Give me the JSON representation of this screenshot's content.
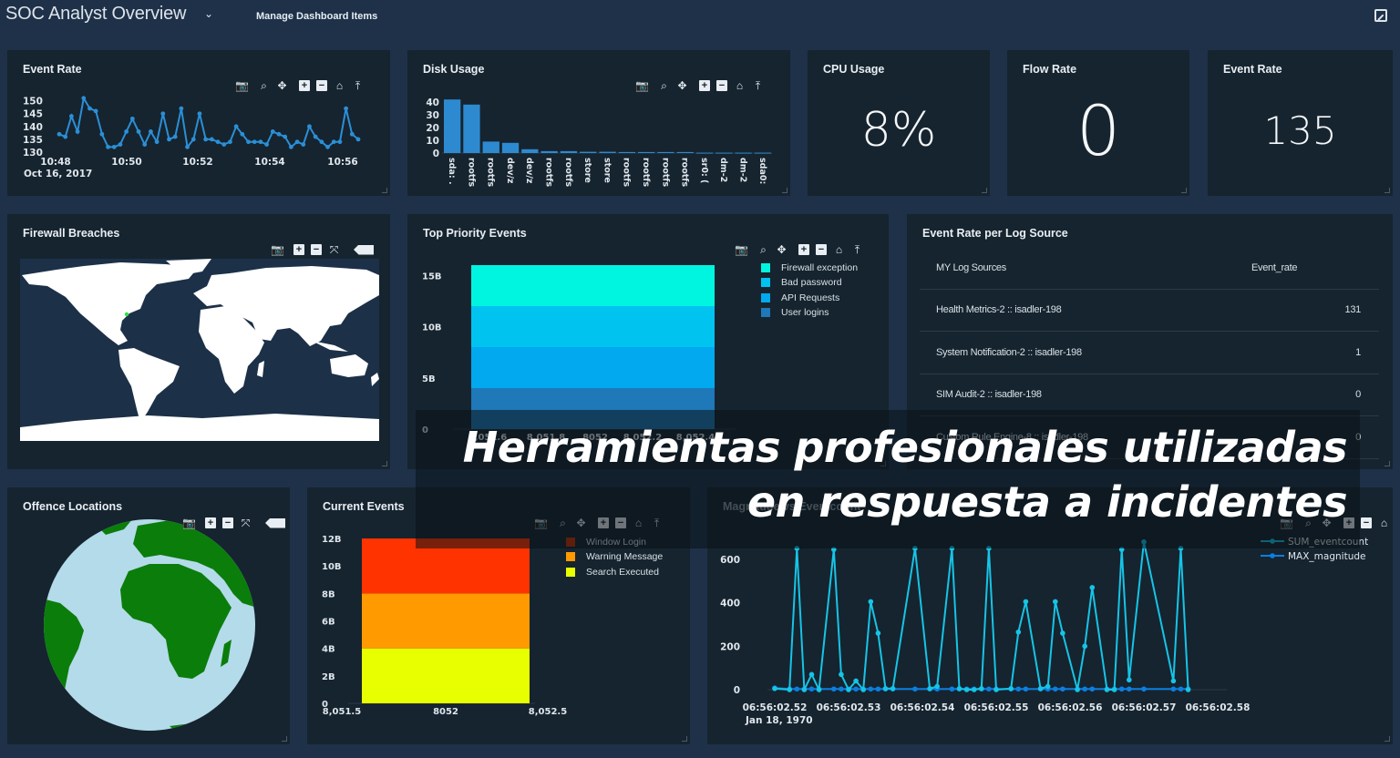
{
  "header": {
    "title": "SOC Analyst Overview",
    "chevron": "⌄",
    "manage_label": "Manage Dashboard Items",
    "popout_icon": "popout-icon"
  },
  "colors": {
    "background": "#1e3148",
    "panel": "#16242f",
    "line_blue": "#2b8fd6",
    "bar_blue": "#2d8ad0"
  },
  "toolbar_icons": [
    "camera-icon",
    "zoom-icon",
    "pan-icon",
    "zoom-in-icon",
    "zoom-out-icon",
    "home-icon",
    "autoscale-icon"
  ],
  "map_toolbar_icons": [
    "camera-icon",
    "zoom-in-icon",
    "zoom-out-icon",
    "fit-icon",
    "tag-icon"
  ],
  "panels": {
    "event_rate_chart": {
      "title": "Event Rate"
    },
    "disk_usage": {
      "title": "Disk Usage"
    },
    "cpu_usage": {
      "title": "CPU Usage",
      "value": "8%"
    },
    "flow_rate": {
      "title": "Flow Rate",
      "value": "0"
    },
    "event_rate_kpi": {
      "title": "Event Rate",
      "value": "135"
    },
    "firewall_breaches": {
      "title": "Firewall Breaches",
      "marker": "United States East Coast"
    },
    "top_priority": {
      "title": "Top Priority Events"
    },
    "log_source": {
      "title": "Event Rate per Log Source",
      "headers": [
        "MY Log Sources",
        "Event_rate"
      ],
      "rows": [
        [
          "Health Metrics-2 :: isadler-198",
          "131"
        ],
        [
          "System Notification-2 :: isadler-198",
          "1"
        ],
        [
          "SIM Audit-2 :: isadler-198",
          "0"
        ],
        [
          "Custom Rule Engine-8 :: isadler-198",
          "0"
        ]
      ]
    },
    "offence_locations": {
      "title": "Offence Locations"
    },
    "current_events": {
      "title": "Current Events"
    },
    "magnitude": {
      "title": "Magnitude vs Eventcount"
    }
  },
  "overlay": {
    "line1": "Herramientas profesionales utilizadas",
    "line2": "en respuesta a incidentes"
  },
  "chart_data": [
    {
      "id": "event_rate",
      "type": "line",
      "title": "Event Rate",
      "ylim": [
        130,
        152
      ],
      "yticks": [
        "150",
        "145",
        "140",
        "135",
        "130"
      ],
      "ytick_values": [
        150,
        145,
        140,
        135,
        130
      ],
      "xticks": [
        "10:48",
        "10:50",
        "10:52",
        "10:54",
        "10:56"
      ],
      "xsub": "Oct 16, 2017",
      "values": [
        137,
        136,
        144,
        138,
        151,
        147,
        146,
        137,
        132,
        132,
        133,
        138,
        143,
        138,
        133,
        138,
        134,
        145,
        135,
        136,
        147,
        132,
        135,
        145,
        135,
        135,
        134,
        133,
        134,
        140,
        137,
        134,
        134,
        134,
        133,
        138,
        137,
        136,
        132,
        134,
        133,
        140,
        136,
        134,
        132,
        134,
        134,
        147,
        137,
        135
      ]
    },
    {
      "id": "disk_usage",
      "type": "bar",
      "title": "Disk Usage",
      "ylim": [
        0,
        45
      ],
      "yticks": [
        "40",
        "30",
        "20",
        "10",
        "0"
      ],
      "ytick_values": [
        40,
        30,
        20,
        10,
        0
      ],
      "categories": [
        "sda: .",
        "rootfs",
        "rootfs",
        "dev/z",
        "dev/z",
        "rootfs",
        "rootfs",
        "store",
        "store",
        "rootfs",
        "rootfs",
        "rootfs",
        "rootfs",
        "sr0: (",
        "dm-2",
        "dm-2",
        "sda0:"
      ],
      "values": [
        42,
        38,
        9,
        8,
        3,
        1.5,
        1.5,
        1,
        1,
        0.8,
        0.8,
        0.8,
        0.8,
        0.3,
        0.3,
        0.3,
        0.3
      ]
    },
    {
      "id": "top_priority",
      "type": "bar",
      "stacked": true,
      "title": "Top Priority Events",
      "ylim": [
        0,
        16
      ],
      "yticks": [
        "15B",
        "10B",
        "5B",
        "0"
      ],
      "ytick_values": [
        15,
        10,
        5,
        0
      ],
      "xticks": [
        "8,051.6",
        "8,051.8",
        "8052",
        "8,052.2",
        "8,052.4"
      ],
      "series": [
        {
          "name": "User logins",
          "value": 4,
          "color": "#1f78b8"
        },
        {
          "name": "API Requests",
          "value": 4,
          "color": "#02a9ef"
        },
        {
          "name": "Bad password",
          "value": 4,
          "color": "#00c3f0"
        },
        {
          "name": "Firewall exception",
          "value": 4,
          "color": "#00f5e0"
        }
      ],
      "legend": [
        "Firewall exception",
        "Bad password",
        "API Requests",
        "User logins"
      ]
    },
    {
      "id": "current_events",
      "type": "bar",
      "stacked": true,
      "title": "Current Events",
      "ylim": [
        0,
        12.6
      ],
      "yticks": [
        "12B",
        "10B",
        "8B",
        "6B",
        "4B",
        "2B",
        "0"
      ],
      "ytick_values": [
        12,
        10,
        8,
        6,
        4,
        2,
        0
      ],
      "xticks": [
        "8,051.5",
        "8052",
        "8,052.5"
      ],
      "series": [
        {
          "name": "Search Executed",
          "value": 4,
          "color": "#e8ff00"
        },
        {
          "name": "Warning Message",
          "value": 4,
          "color": "#ff9a00"
        },
        {
          "name": "Window Login",
          "value": 4,
          "color": "#ff3300"
        }
      ],
      "legend": [
        "Window Login",
        "Warning Message",
        "Search Executed"
      ],
      "legend_colors": [
        "#c43200",
        "#ff9a00",
        "#e8ff00"
      ]
    },
    {
      "id": "magnitude",
      "type": "line",
      "title": "Magnitude vs Eventcount",
      "ylim": [
        0,
        700
      ],
      "yticks": [
        "600",
        "400",
        "200",
        "0"
      ],
      "ytick_values": [
        600,
        400,
        200,
        0
      ],
      "xticks": [
        "06:56:02.52",
        "06:56:02.53",
        "06:56:02.54",
        "06:56:02.55",
        "06:56:02.56",
        "06:56:02.57",
        "06:56:02.58"
      ],
      "xsub": "Jan 18, 1970",
      "series": [
        {
          "name": "SUM_eventcount",
          "color": "#16c4e6",
          "points": [
            [
              0,
              5
            ],
            [
              2,
              0
            ],
            [
              3,
              650
            ],
            [
              4,
              0
            ],
            [
              5,
              70
            ],
            [
              6,
              0
            ],
            [
              8,
              645
            ],
            [
              9,
              70
            ],
            [
              10,
              0
            ],
            [
              11,
              40
            ],
            [
              12,
              0
            ],
            [
              13,
              405
            ],
            [
              14,
              260
            ],
            [
              15,
              5
            ],
            [
              16,
              5
            ],
            [
              19,
              650
            ],
            [
              21,
              5
            ],
            [
              22,
              15
            ],
            [
              24,
              650
            ],
            [
              25,
              5
            ],
            [
              26,
              0
            ],
            [
              27,
              0
            ],
            [
              28,
              5
            ],
            [
              29,
              650
            ],
            [
              30,
              0
            ],
            [
              32,
              5
            ],
            [
              33,
              265
            ],
            [
              34,
              405
            ],
            [
              36,
              5
            ],
            [
              37,
              15
            ],
            [
              38,
              405
            ],
            [
              39,
              260
            ],
            [
              41,
              0
            ],
            [
              42,
              200
            ],
            [
              43,
              470
            ],
            [
              45,
              0
            ],
            [
              46,
              0
            ],
            [
              47,
              645
            ],
            [
              48,
              45
            ],
            [
              50,
              680
            ],
            [
              54,
              40
            ],
            [
              55,
              650
            ],
            [
              56,
              0
            ]
          ]
        },
        {
          "name": "MAX_magnitude",
          "color": "#0b7fe0",
          "points": [
            [
              0,
              8
            ],
            [
              2,
              3
            ],
            [
              3,
              3
            ],
            [
              4,
              3
            ],
            [
              5,
              3
            ],
            [
              6,
              3
            ],
            [
              8,
              3
            ],
            [
              9,
              3
            ],
            [
              10,
              3
            ],
            [
              11,
              3
            ],
            [
              12,
              3
            ],
            [
              13,
              3
            ],
            [
              14,
              3
            ],
            [
              15,
              3
            ],
            [
              16,
              3
            ],
            [
              19,
              3
            ],
            [
              21,
              3
            ],
            [
              22,
              3
            ],
            [
              24,
              3
            ],
            [
              25,
              3
            ],
            [
              26,
              3
            ],
            [
              27,
              3
            ],
            [
              28,
              3
            ],
            [
              29,
              3
            ],
            [
              30,
              3
            ],
            [
              32,
              3
            ],
            [
              33,
              3
            ],
            [
              34,
              3
            ],
            [
              36,
              3
            ],
            [
              37,
              3
            ],
            [
              38,
              3
            ],
            [
              39,
              3
            ],
            [
              41,
              3
            ],
            [
              42,
              3
            ],
            [
              43,
              3
            ],
            [
              45,
              3
            ],
            [
              46,
              3
            ],
            [
              47,
              3
            ],
            [
              48,
              3
            ],
            [
              50,
              3
            ],
            [
              54,
              3
            ],
            [
              55,
              3
            ],
            [
              56,
              3
            ]
          ]
        }
      ],
      "xmax": 60
    }
  ]
}
